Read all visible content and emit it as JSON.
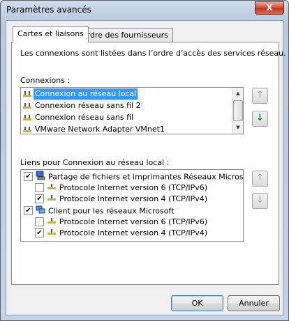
{
  "window": {
    "title": "Paramètres avancés",
    "close_symbol": "X"
  },
  "tabs": [
    {
      "label": "Cartes et liaisons",
      "active": true
    },
    {
      "label": "Ordre des fournisseurs",
      "active": false
    }
  ],
  "description": "Les connexions sont listées dans l’ordre d’accès des services réseau.",
  "connections": {
    "label": "Connexions :",
    "items": [
      {
        "label": "Connexion au réseau local",
        "selected": true
      },
      {
        "label": "Connexion réseau sans fil 2",
        "selected": false
      },
      {
        "label": "Connexion réseau sans fil",
        "selected": false
      },
      {
        "label": "VMware Network Adapter VMnet1",
        "selected": false
      }
    ]
  },
  "bindings": {
    "label": "Liens pour Connexion au réseau local :",
    "items": [
      {
        "label": "Partage de fichiers et imprimantes Réseaux Microsoft",
        "checked": true,
        "level": 0
      },
      {
        "label": "Protocole Internet version 6 (TCP/IPv6)",
        "checked": false,
        "level": 1
      },
      {
        "label": "Protocole Internet version 4 (TCP/IPv4)",
        "checked": true,
        "level": 1
      },
      {
        "label": "Client pour les réseaux Microsoft",
        "checked": true,
        "level": 0
      },
      {
        "label": "Protocole Internet version 6 (TCP/IPv6)",
        "checked": false,
        "level": 1
      },
      {
        "label": "Protocole Internet version 4 (TCP/IPv4)",
        "checked": true,
        "level": 1
      }
    ]
  },
  "buttons": {
    "ok": "OK",
    "cancel": "Annuler"
  },
  "icons": {
    "move_up": "up-arrow-icon",
    "move_down": "down-arrow-icon",
    "checkmark": "✔",
    "accent_green": "#1a9a1a",
    "selection_blue": "#3399ff"
  }
}
